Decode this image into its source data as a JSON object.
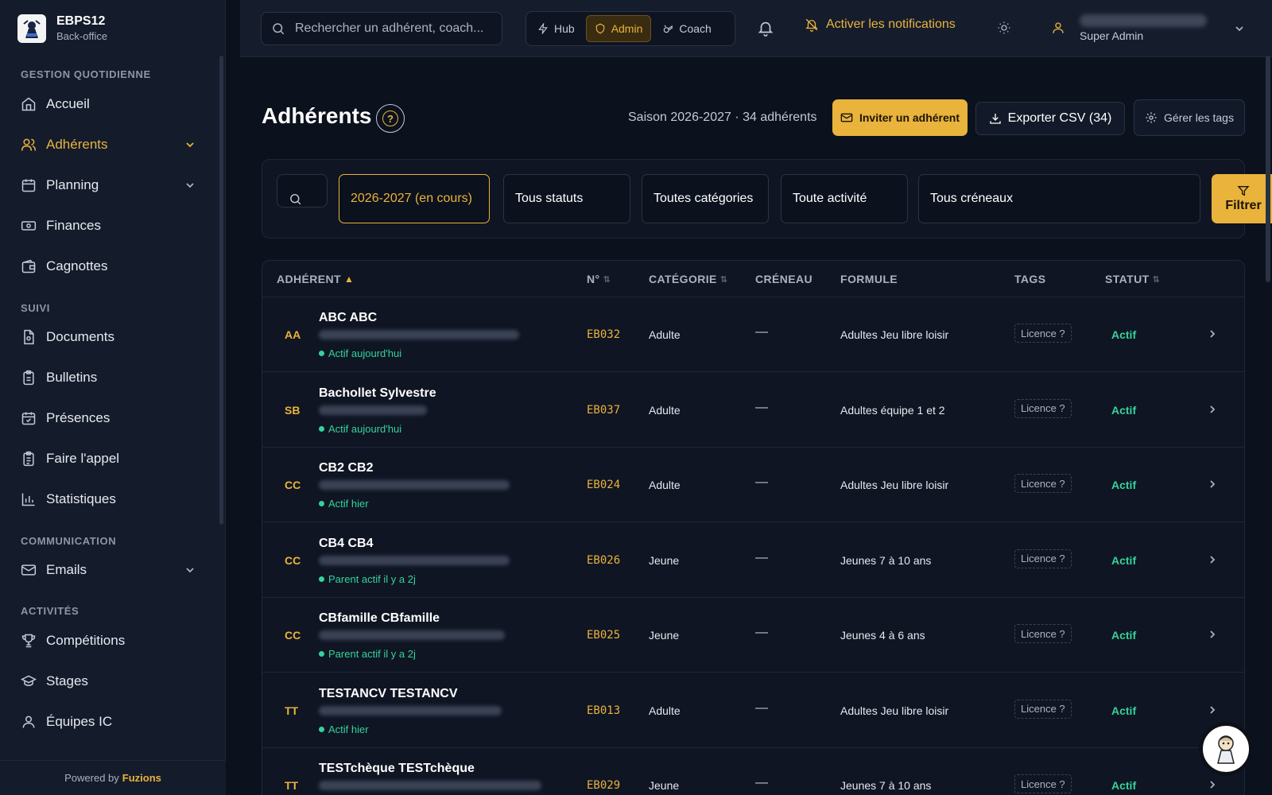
{
  "brand": {
    "title": "EBPS12",
    "subtitle": "Back-office"
  },
  "sidebar": {
    "sections": [
      {
        "title": "GESTION QUOTIDIENNE"
      },
      {
        "title": "SUIVI"
      },
      {
        "title": "COMMUNICATION"
      },
      {
        "title": "ACTIVITÉS"
      }
    ],
    "items": [
      {
        "label": "Accueil",
        "icon": "home-icon"
      },
      {
        "label": "Adhérents",
        "icon": "users-icon",
        "active": true
      },
      {
        "label": "Planning",
        "icon": "calendar-icon"
      },
      {
        "label": "Finances",
        "icon": "banknote-icon"
      },
      {
        "label": "Cagnottes",
        "icon": "wallet-icon"
      },
      {
        "label": "Documents",
        "icon": "document-icon"
      },
      {
        "label": "Bulletins",
        "icon": "clipboard-icon"
      },
      {
        "label": "Présences",
        "icon": "calendar-check-icon"
      },
      {
        "label": "Faire l'appel",
        "icon": "clipboard-list-icon"
      },
      {
        "label": "Statistiques",
        "icon": "bar-chart-icon"
      },
      {
        "label": "Emails",
        "icon": "mail-icon"
      },
      {
        "label": "Compétitions",
        "icon": "trophy-icon"
      },
      {
        "label": "Stages",
        "icon": "graduation-cap-icon"
      },
      {
        "label": "Équipes IC",
        "icon": "team-icon"
      }
    ],
    "footer": {
      "prefix": "Powered by",
      "name": "Fuzions"
    }
  },
  "header": {
    "search_placeholder": "Rechercher un adhérent, coach...",
    "switcher": [
      {
        "label": "Hub",
        "icon": "zap-icon"
      },
      {
        "label": "Admin",
        "icon": "shield-icon",
        "active": true
      },
      {
        "label": "Coach",
        "icon": "whistle-icon"
      }
    ],
    "notifications_label": "Activer les notifications",
    "user_role": "Super Admin"
  },
  "page": {
    "title": "Adhérents",
    "help_symbol": "?",
    "season_info": "Saison 2026-2027 · 34 adhérents",
    "invite_label": "Inviter un adhérent",
    "export_label": "Exporter CSV (34)",
    "tags_label": "Gérer les tags"
  },
  "filters": {
    "season": "2026-2027 (en cours)",
    "status": "Tous statuts",
    "category": "Toutes catégories",
    "activity": "Toute activité",
    "slot": "Tous créneaux",
    "button": "Filtrer"
  },
  "table": {
    "columns": {
      "member": "ADHÉRENT",
      "number": "N°",
      "category": "CATÉGORIE",
      "slot": "CRÉNEAU",
      "formula": "FORMULE",
      "tags": "TAGS",
      "status": "STATUT"
    },
    "rows": [
      {
        "initials": "AA",
        "name": "ABC ABC",
        "activity": "Actif aujourd'hui",
        "number": "EB032",
        "category": "Adulte",
        "slot": "—",
        "formula": "Adultes Jeu libre loisir",
        "tag": "Licence ?",
        "status": "Actif"
      },
      {
        "initials": "SB",
        "name": "Bachollet Sylvestre",
        "activity": "Actif aujourd'hui",
        "number": "EB037",
        "category": "Adulte",
        "slot": "—",
        "formula": "Adultes équipe 1 et 2",
        "tag": "Licence ?",
        "status": "Actif"
      },
      {
        "initials": "CC",
        "name": "CB2 CB2",
        "activity": "Actif hier",
        "number": "EB024",
        "category": "Adulte",
        "slot": "—",
        "formula": "Adultes Jeu libre loisir",
        "tag": "Licence ?",
        "status": "Actif"
      },
      {
        "initials": "CC",
        "name": "CB4 CB4",
        "activity": "Parent actif il y a 2j",
        "number": "EB026",
        "category": "Jeune",
        "slot": "—",
        "formula": "Jeunes 7 à 10 ans",
        "tag": "Licence ?",
        "status": "Actif"
      },
      {
        "initials": "CC",
        "name": "CBfamille CBfamille",
        "activity": "Parent actif il y a 2j",
        "number": "EB025",
        "category": "Jeune",
        "slot": "—",
        "formula": "Jeunes 4 à 6 ans",
        "tag": "Licence ?",
        "status": "Actif"
      },
      {
        "initials": "TT",
        "name": "TESTANCV TESTANCV",
        "activity": "Actif hier",
        "number": "EB013",
        "category": "Adulte",
        "slot": "—",
        "formula": "Adultes Jeu libre loisir",
        "tag": "Licence ?",
        "status": "Actif"
      },
      {
        "initials": "TT",
        "name": "TESTchèque TESTchèque",
        "activity": "",
        "number": "EB029",
        "category": "Jeune",
        "slot": "—",
        "formula": "Jeunes 7 à 10 ans",
        "tag": "Licence ?",
        "status": "Actif"
      }
    ]
  },
  "colors": {
    "accent": "#e9b33c",
    "success": "#34d399",
    "background": "#0b111d",
    "sidebar": "#141b2b"
  }
}
